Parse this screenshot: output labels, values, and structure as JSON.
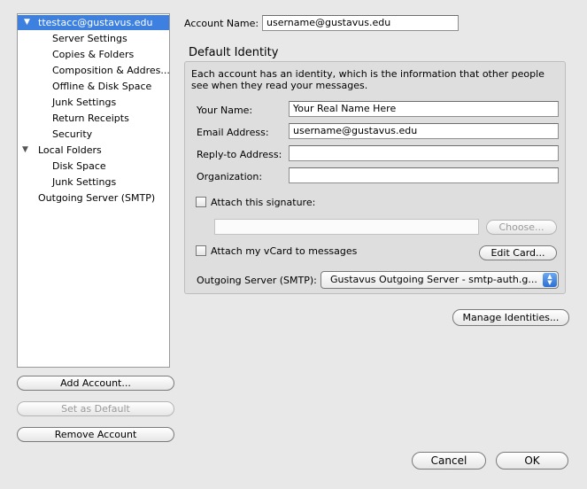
{
  "tree": {
    "items": [
      {
        "label": "ttestacc@gustavus.edu",
        "expanded": true,
        "selected": true
      },
      {
        "label": "Server Settings"
      },
      {
        "label": "Copies & Folders"
      },
      {
        "label": "Composition & Addres..."
      },
      {
        "label": "Offline & Disk Space"
      },
      {
        "label": "Junk Settings"
      },
      {
        "label": "Return Receipts"
      },
      {
        "label": "Security"
      },
      {
        "label": "Local Folders",
        "expanded": true
      },
      {
        "label": "Disk Space"
      },
      {
        "label": "Junk Settings"
      },
      {
        "label": "Outgoing Server (SMTP)"
      }
    ]
  },
  "left_buttons": {
    "add_account": "Add Account...",
    "set_default": "Set as Default",
    "remove_account": "Remove Account"
  },
  "account": {
    "name_label": "Account Name:",
    "name_value": "username@gustavus.edu"
  },
  "identity": {
    "heading": "Default Identity",
    "description": "Each account has an identity, which is the information that other people see when they read your messages.",
    "your_name_label": "Your Name:",
    "your_name_value": "Your Real Name Here",
    "email_label": "Email Address:",
    "email_value": "username@gustavus.edu",
    "reply_to_label": "Reply-to Address:",
    "reply_to_value": "",
    "organization_label": "Organization:",
    "organization_value": "",
    "attach_signature_label": "Attach this signature:",
    "signature_path": "",
    "choose_label": "Choose...",
    "attach_vcard_label": "Attach my vCard to messages",
    "edit_card_label": "Edit Card...",
    "smtp_label": "Outgoing Server (SMTP):",
    "smtp_value": "Gustavus Outgoing Server - smtp-auth.g..."
  },
  "manage_identities_label": "Manage Identities...",
  "footer": {
    "cancel_label": "Cancel",
    "ok_label": "OK"
  }
}
